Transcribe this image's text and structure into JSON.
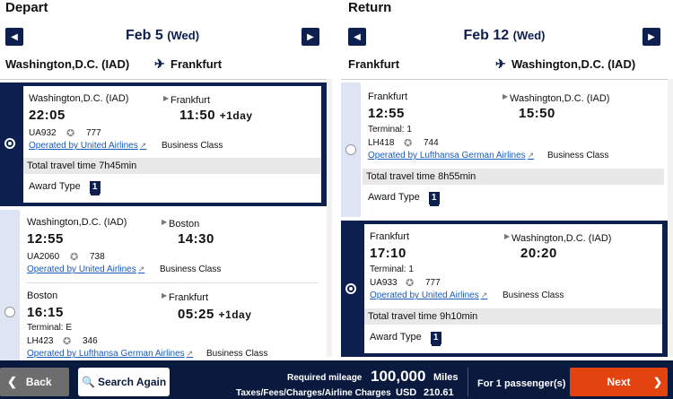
{
  "depart": {
    "title": "Depart",
    "date": "Feb 5",
    "dow": "(Wed)",
    "route_from": "Washington,D.C. (IAD)",
    "route_to": "Frankfurt",
    "flights": [
      {
        "selected": true,
        "travel_time": "Total travel time 7h45min",
        "award_label": "Award Type",
        "award_value": "1",
        "legs": [
          {
            "dep_city": "Washington,D.C. (IAD)",
            "arr_city": "Frankfurt",
            "dep_time": "22:05",
            "arr_time": "11:50",
            "plus": "+1day",
            "terminal": "",
            "flight_no": "UA932",
            "aircraft": "777",
            "operator": "Operated by United Airlines",
            "cabin": "Business Class"
          }
        ]
      },
      {
        "selected": false,
        "legs": [
          {
            "dep_city": "Washington,D.C. (IAD)",
            "arr_city": "Boston",
            "dep_time": "12:55",
            "arr_time": "14:30",
            "plus": "",
            "terminal": "",
            "flight_no": "UA2060",
            "aircraft": "738",
            "operator": "Operated by United Airlines",
            "cabin": "Business Class"
          },
          {
            "dep_city": "Boston",
            "arr_city": "Frankfurt",
            "dep_time": "16:15",
            "arr_time": "05:25",
            "plus": "+1day",
            "terminal": "Terminal: E",
            "flight_no": "LH423",
            "aircraft": "346",
            "operator": "Operated by Lufthansa German Airlines",
            "cabin": "Business Class"
          }
        ]
      }
    ]
  },
  "return": {
    "title": "Return",
    "date": "Feb 12",
    "dow": "(Wed)",
    "route_from": "Frankfurt",
    "route_to": "Washington,D.C. (IAD)",
    "flights": [
      {
        "selected": false,
        "travel_time": "Total travel time 8h55min",
        "award_label": "Award Type",
        "award_value": "1",
        "legs": [
          {
            "dep_city": "Frankfurt",
            "arr_city": "Washington,D.C. (IAD)",
            "dep_time": "12:55",
            "arr_time": "15:50",
            "plus": "",
            "terminal": "Terminal: 1",
            "flight_no": "LH418",
            "aircraft": "744",
            "operator": "Operated by Lufthansa German Airlines",
            "cabin": "Business Class"
          }
        ]
      },
      {
        "selected": true,
        "travel_time": "Total travel time 9h10min",
        "award_label": "Award Type",
        "award_value": "1",
        "legs": [
          {
            "dep_city": "Frankfurt",
            "arr_city": "Washington,D.C. (IAD)",
            "dep_time": "17:10",
            "arr_time": "20:20",
            "plus": "",
            "terminal": "Terminal: 1",
            "flight_no": "UA933",
            "aircraft": "777",
            "operator": "Operated by United Airlines",
            "cabin": "Business Class"
          }
        ]
      }
    ]
  },
  "footer": {
    "back_label": "Back",
    "search_again_label": "Search Again",
    "required_mileage_label": "Required mileage",
    "required_mileage_value": "100,000",
    "miles_unit": "Miles",
    "taxes_label": "Taxes/Fees/Charges/Airline Charges",
    "taxes_currency": "USD",
    "taxes_value": "210.61",
    "passengers": "For 1 passenger(s)",
    "next_label": "Next"
  },
  "icons": {
    "prev": "chevron-left-icon",
    "next": "chevron-right-icon",
    "plane": "plane-icon",
    "external": "external-link-icon",
    "star_alliance": "star-alliance-logo-icon",
    "search": "search-icon"
  },
  "colors": {
    "navy": "#0d1f4f",
    "footer": "#0a1a3f",
    "next_button": "#e3430f",
    "link": "#1a5ab8"
  }
}
